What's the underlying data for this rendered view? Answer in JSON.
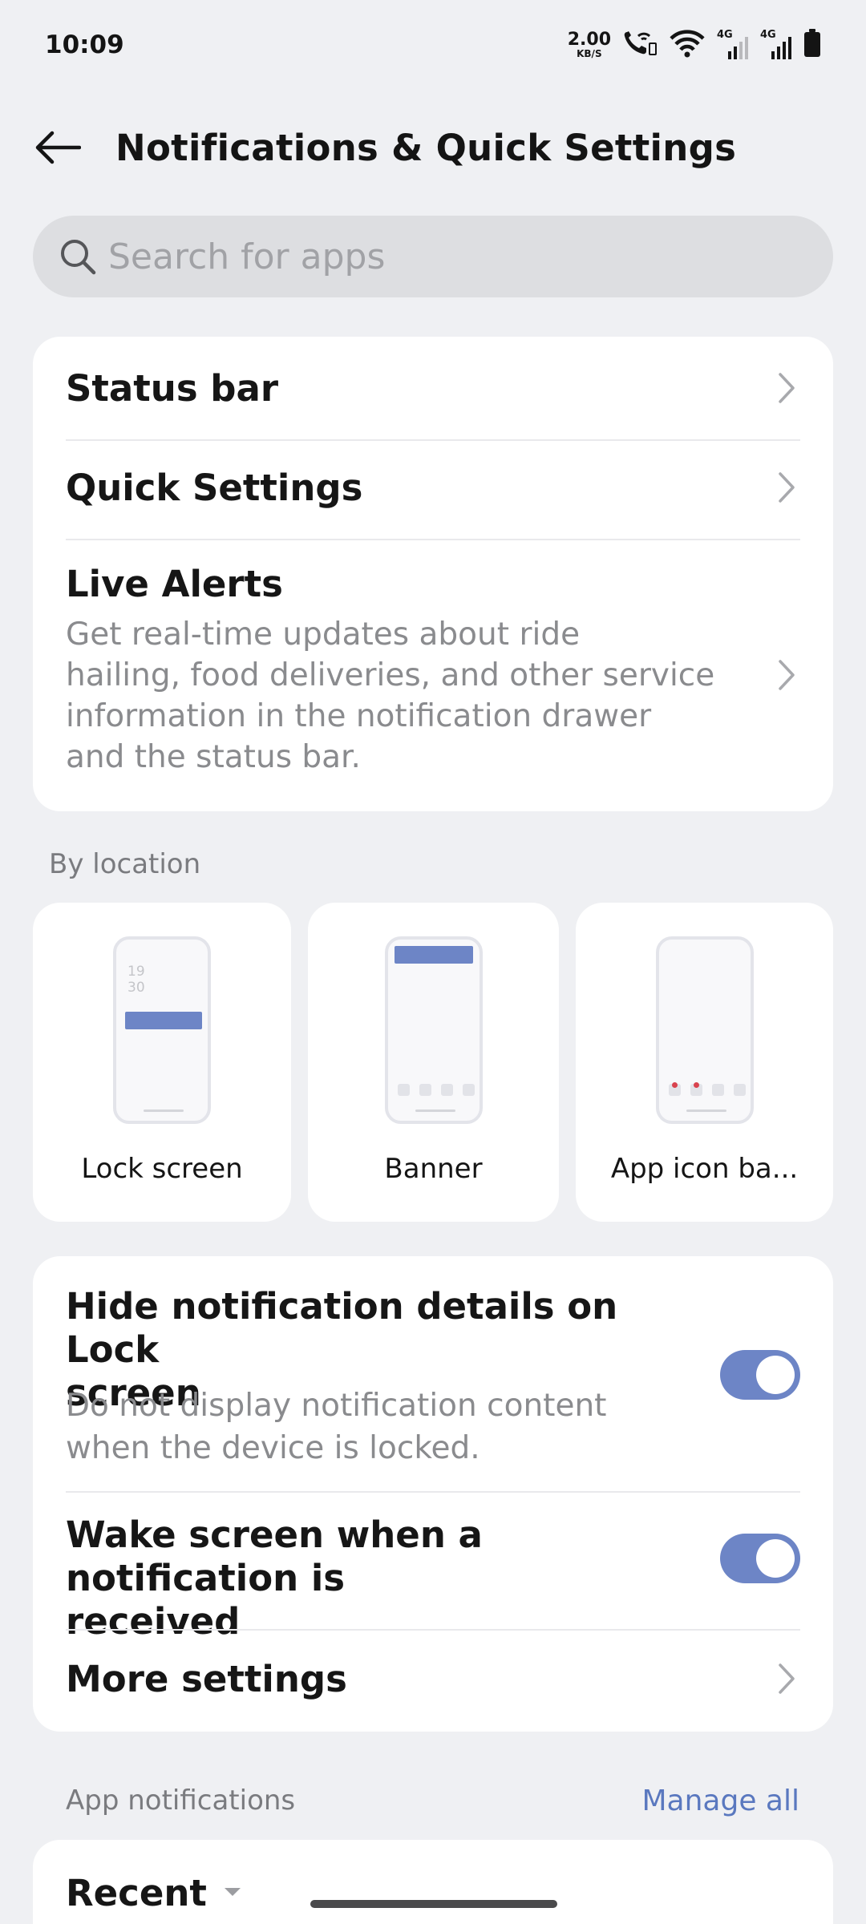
{
  "status_bar": {
    "time": "10:09",
    "speed_value": "2.00",
    "speed_unit": "KB/S",
    "net1": "4G",
    "net2": "4G",
    "icons": [
      "wifi-call-icon",
      "wifi-icon",
      "signal-icon",
      "signal-icon",
      "battery-icon"
    ]
  },
  "header": {
    "title": "Notifications & Quick Settings",
    "back_icon": "back-arrow-icon"
  },
  "search": {
    "placeholder": "Search for apps",
    "icon": "search-icon"
  },
  "top_card": {
    "status_bar": "Status bar",
    "quick_settings": "Quick Settings",
    "live_alerts_title": "Live Alerts",
    "live_alerts_desc_lines": [
      "Get real-time updates about ride",
      "hailing, food deliveries, and other service",
      "information in the notification drawer",
      "and the status bar."
    ]
  },
  "by_location": {
    "label": "By location",
    "lock_screen": "Lock screen",
    "lock_time_hour": "19",
    "lock_time_min": "30",
    "banner": "Banner",
    "app_icon_badges": "App icon ba..."
  },
  "settings_card": {
    "hide_details_title_lines": [
      "Hide notification details on Lock",
      "screen"
    ],
    "hide_details_desc_lines": [
      "Do not display notification content",
      "when the device is locked."
    ],
    "hide_details_on": true,
    "wake_screen_title_lines": [
      "Wake screen when a notification is",
      "received"
    ],
    "wake_screen_on": true,
    "more_settings": "More settings"
  },
  "app_notifications": {
    "label": "App notifications",
    "manage_all": "Manage all",
    "filter": "Recent"
  },
  "colors": {
    "accent": "#6d85c6",
    "link": "#5a78bf",
    "background": "#eff0f3"
  }
}
